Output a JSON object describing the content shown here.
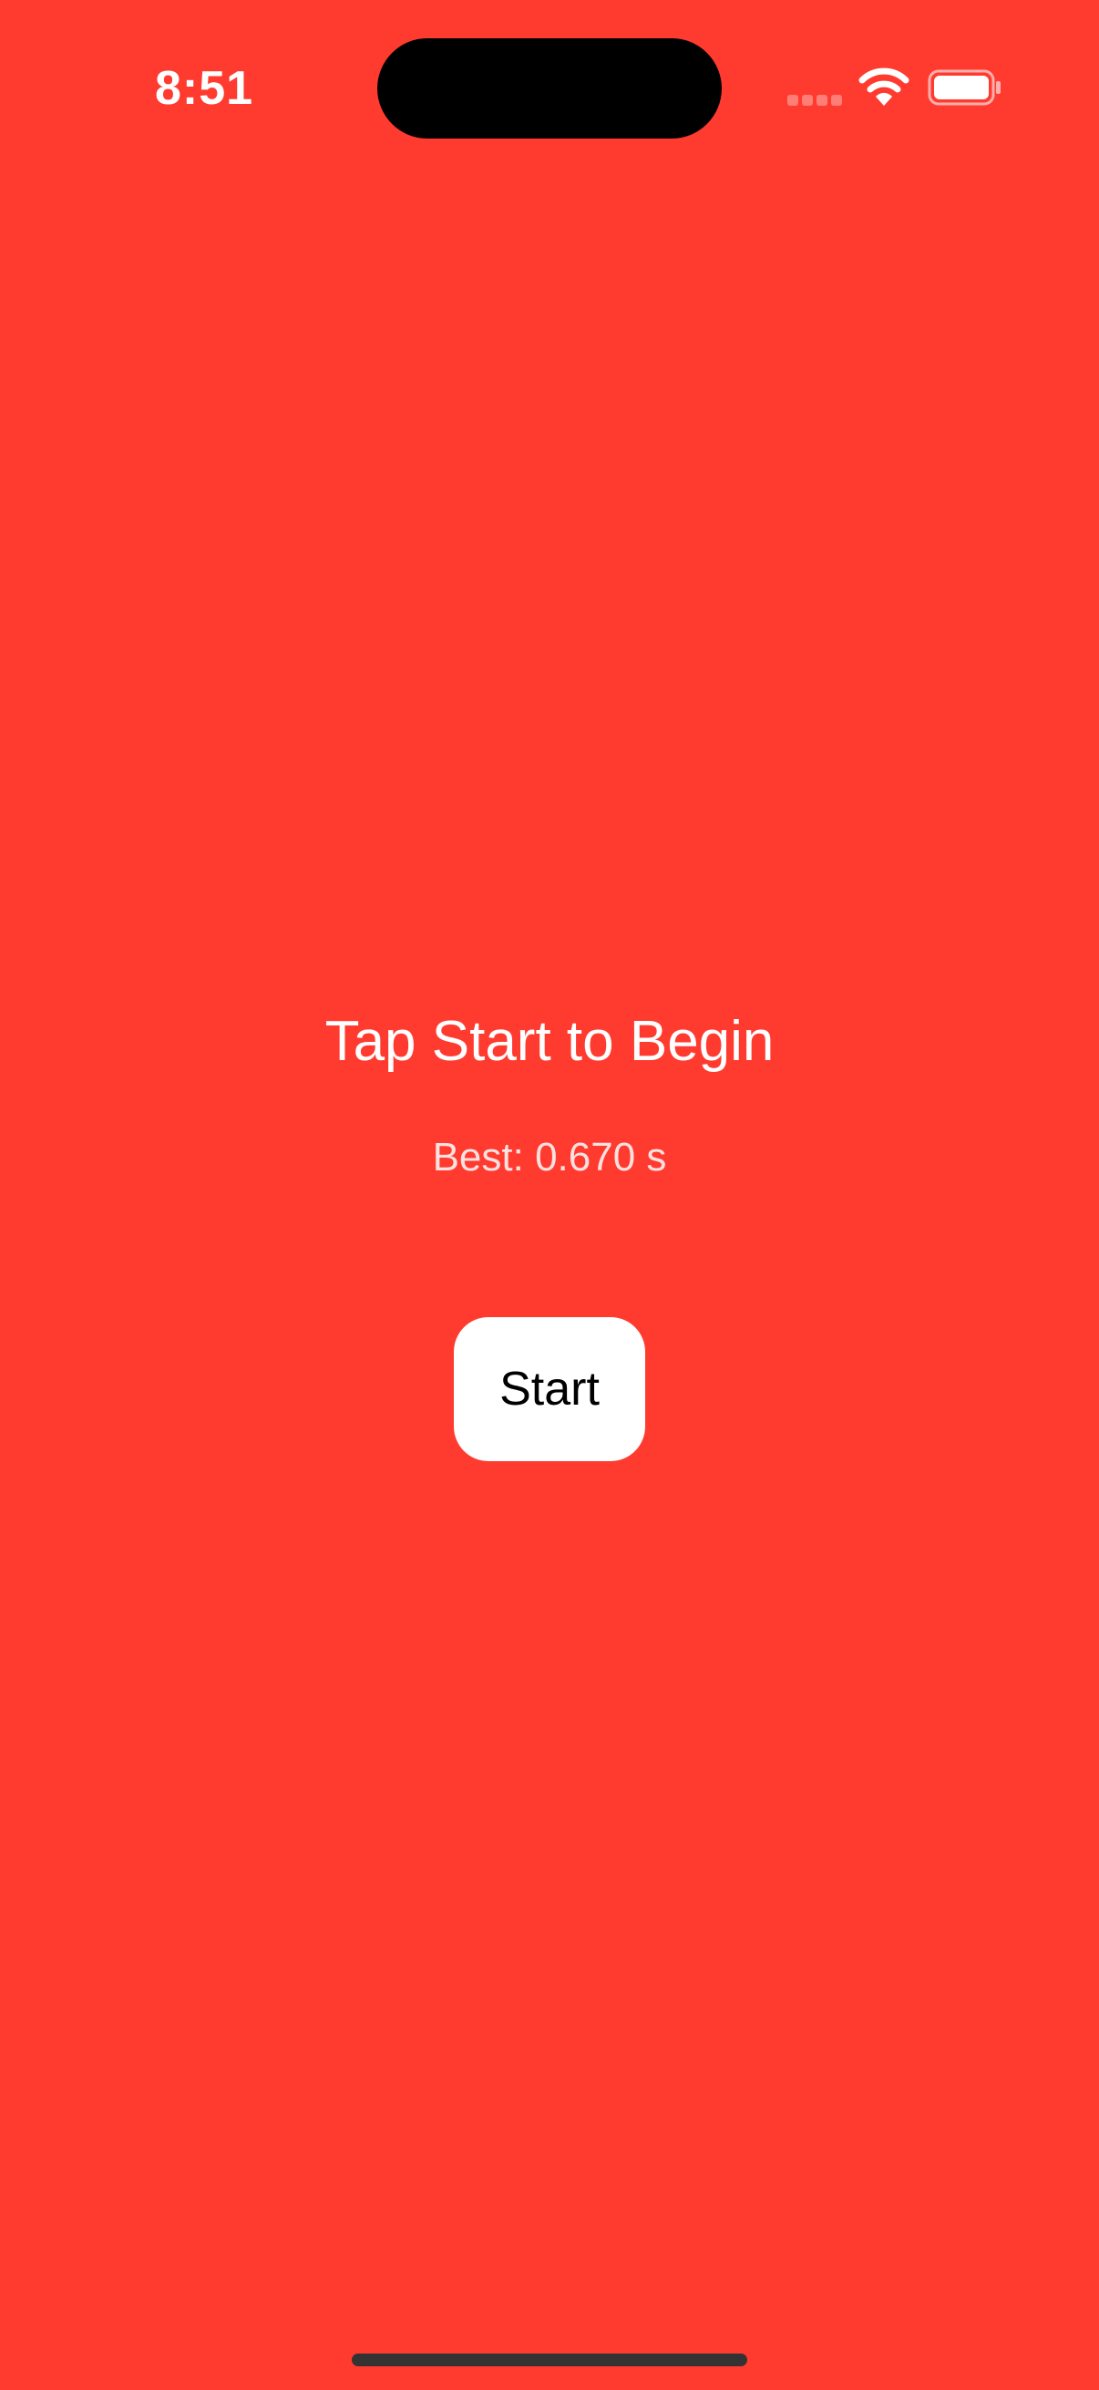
{
  "status_bar": {
    "time": "8:51"
  },
  "main": {
    "title": "Tap Start to Begin",
    "best_score": "Best: 0.670 s",
    "start_label": "Start"
  },
  "colors": {
    "background": "#FF3B30",
    "text": "#FFFFFF",
    "button_background": "#FFFFFF",
    "button_text": "#000000"
  },
  "icons": [
    "cell-signal-icon",
    "wifi-icon",
    "battery-icon"
  ]
}
